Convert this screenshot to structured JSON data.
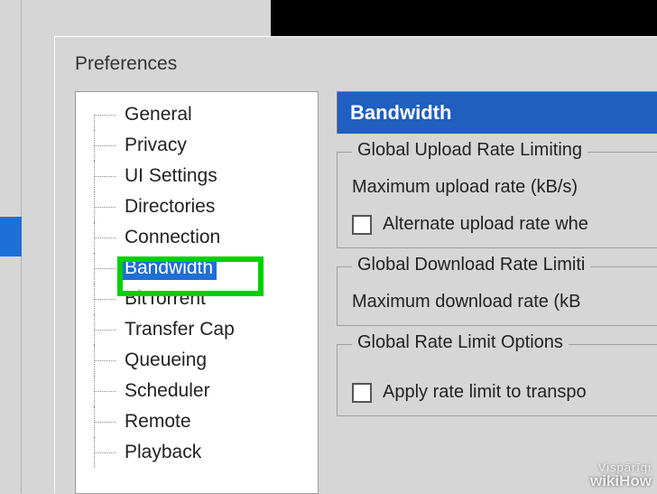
{
  "window": {
    "title": "Preferences"
  },
  "tree": {
    "items": [
      {
        "label": "General",
        "selected": false
      },
      {
        "label": "Privacy",
        "selected": false
      },
      {
        "label": "UI Settings",
        "selected": false
      },
      {
        "label": "Directories",
        "selected": false
      },
      {
        "label": "Connection",
        "selected": false
      },
      {
        "label": "Bandwidth",
        "selected": true
      },
      {
        "label": "BitTorrent",
        "selected": false
      },
      {
        "label": "Transfer Cap",
        "selected": false
      },
      {
        "label": "Queueing",
        "selected": false
      },
      {
        "label": "Scheduler",
        "selected": false
      },
      {
        "label": "Remote",
        "selected": false
      },
      {
        "label": "Playback",
        "selected": false
      }
    ]
  },
  "content": {
    "header": "Bandwidth",
    "groups": [
      {
        "title": "Global Upload Rate Limiting",
        "rows": [
          {
            "type": "text",
            "label": "Maximum upload rate (kB/s)"
          },
          {
            "type": "check",
            "label": "Alternate upload rate whe",
            "checked": false
          }
        ]
      },
      {
        "title": "Global Download Rate Limiti",
        "rows": [
          {
            "type": "text",
            "label": "Maximum download rate (kB"
          }
        ]
      },
      {
        "title": "Global Rate Limit Options",
        "rows": [
          {
            "type": "check",
            "label": "Apply rate limit to transpo",
            "checked": false
          }
        ]
      }
    ]
  },
  "watermark": {
    "line1": "Vispārīgi",
    "line2": "wikiHow"
  }
}
